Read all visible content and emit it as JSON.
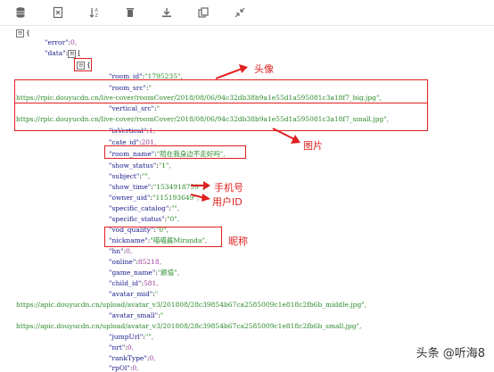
{
  "toolbar": {
    "icons": [
      "database-icon",
      "export-icon",
      "sort-icon",
      "delete-icon",
      "download-icon",
      "copy-icon",
      "collapse-icon"
    ]
  },
  "colors": {
    "key": "#1a1a8c",
    "string": "#2a8a2a",
    "number": "#9c3a9c",
    "annotation": "#e02020"
  },
  "json": {
    "fold_root": "⊟",
    "root_brace": "{",
    "error_key": "\"error\"",
    "error_value": "0,",
    "data_key": "\"data\"",
    "data_value": "[",
    "fold_data": "⊟",
    "fold_obj": "⊟",
    "obj_brace": "{",
    "room_id_key": "\"room_id\"",
    "room_id_value": "\"1795235\",",
    "room_src_key": "\"room_src\"",
    "room_src_value": "\"",
    "room_src_url": "https://rpic.douyucdn.cn/live-cover/roomCover/2018/08/06/94c32db38b9a1e55d1a595081c3a18f7_big.jpg\",",
    "vertical_src_key": "\"vertical_src\"",
    "vertical_src_value": "\"",
    "vertical_src_url": "https://rpic.douyucdn.cn/live-cover/roomCover/2018/08/06/94c32db38b9a1e55d1a595081c3a18f7_small.jpg\",",
    "is_vertical_key": "\"isVertical\"",
    "is_vertical_value": "1,",
    "cate_id_key": "\"cate_id\"",
    "cate_id_value": "201,",
    "room_name_key": "\"room_name\"",
    "room_name_value": "\"陪在我身边不走好吗\",",
    "show_status_key": "\"show_status\"",
    "show_status_value": "\"1\",",
    "subject_key": "\"subject\"",
    "subject_value": "\"\",",
    "show_time_key": "\"show_time\"",
    "show_time_value": "\"1534918759\",",
    "owner_uid_key": "\"owner_uid\"",
    "owner_uid_value": "\"115193649\",",
    "specific_catalog_key": "\"specific_catalog\"",
    "specific_catalog_value": "\"\",",
    "specific_status_key": "\"specific_status\"",
    "specific_status_value": "\"0\",",
    "vod_quality_key": "\"vod_quality\"",
    "vod_quality_value": "\"0\",",
    "nickname_key": "\"nickname\"",
    "nickname_value": "\"喵喵酱Miranda\",",
    "hn_key": "\"hn\"",
    "hn_value": "0,",
    "online_key": "\"online\"",
    "online_value": "85218,",
    "game_name_key": "\"game_name\"",
    "game_name_value": "\"颜值\",",
    "child_id_key": "\"child_id\"",
    "child_id_value": "581,",
    "avatar_mid_key": "\"avatar_mid\"",
    "avatar_mid_value": "\"",
    "avatar_mid_url": "https://apic.douyucdn.cn/upload/avatar_v3/201808/28c39854b67ca2585009c1e818c2fb6b_middle.jpg\",",
    "avatar_small_key": "\"avatar_small\"",
    "avatar_small_value": "\"",
    "avatar_small_url": "https://apic.douyucdn.cn/upload/avatar_v3/201808/28c39854b67ca2585009c1e818c2fb6b_small.jpg\",",
    "jump_url_key": "\"jumpUrl\"",
    "jump_url_value": "\"\",",
    "nrt_key": "\"nrt\"",
    "nrt_value": "0,",
    "rank_type_key": "\"rankType\"",
    "rank_type_value": "0,",
    "last_key": "\"rpOl\"",
    "last_value": "0,"
  },
  "annotations": {
    "avatar": "头像",
    "image": "图片",
    "phone": "手机号",
    "user_id": "用户ID",
    "nickname": "昵称"
  },
  "watermark": "头条 @听海8"
}
